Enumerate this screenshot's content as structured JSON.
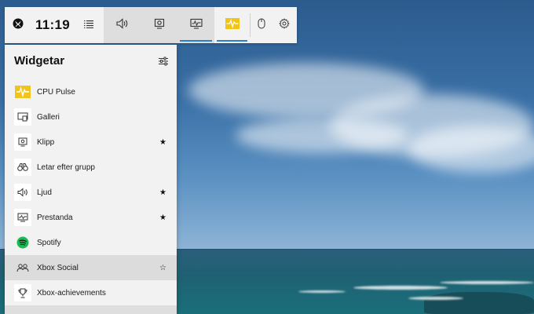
{
  "topbar": {
    "time": "11:19",
    "icons": {
      "xbox": "xbox-logo-icon",
      "menu": "widget-menu-icon",
      "audio": "speaker-icon",
      "capture": "capture-icon",
      "performance": "performance-monitor-icon",
      "cpu_pulse": "cpu-pulse-icon",
      "mouse": "mouse-icon",
      "settings": "gear-icon"
    },
    "accent": "#2b7fd1"
  },
  "panel": {
    "title": "Widgetar",
    "settings_icon": "sliders-icon",
    "items": [
      {
        "label": "CPU Pulse",
        "icon": "cpu-pulse-icon",
        "star": ""
      },
      {
        "label": "Galleri",
        "icon": "gallery-icon",
        "star": ""
      },
      {
        "label": "Klipp",
        "icon": "capture-icon",
        "star": "★"
      },
      {
        "label": "Letar efter grupp",
        "icon": "binoculars-icon",
        "star": ""
      },
      {
        "label": "Ljud",
        "icon": "speaker-icon",
        "star": "★"
      },
      {
        "label": "Prestanda",
        "icon": "performance-monitor-icon",
        "star": "★"
      },
      {
        "label": "Spotify",
        "icon": "spotify-icon",
        "star": ""
      },
      {
        "label": "Xbox Social",
        "icon": "people-icon",
        "star": "☆"
      },
      {
        "label": "Xbox-achievements",
        "icon": "trophy-icon",
        "star": ""
      }
    ],
    "highlight_color": "#f0c419",
    "spotify_color": "#1db954"
  }
}
